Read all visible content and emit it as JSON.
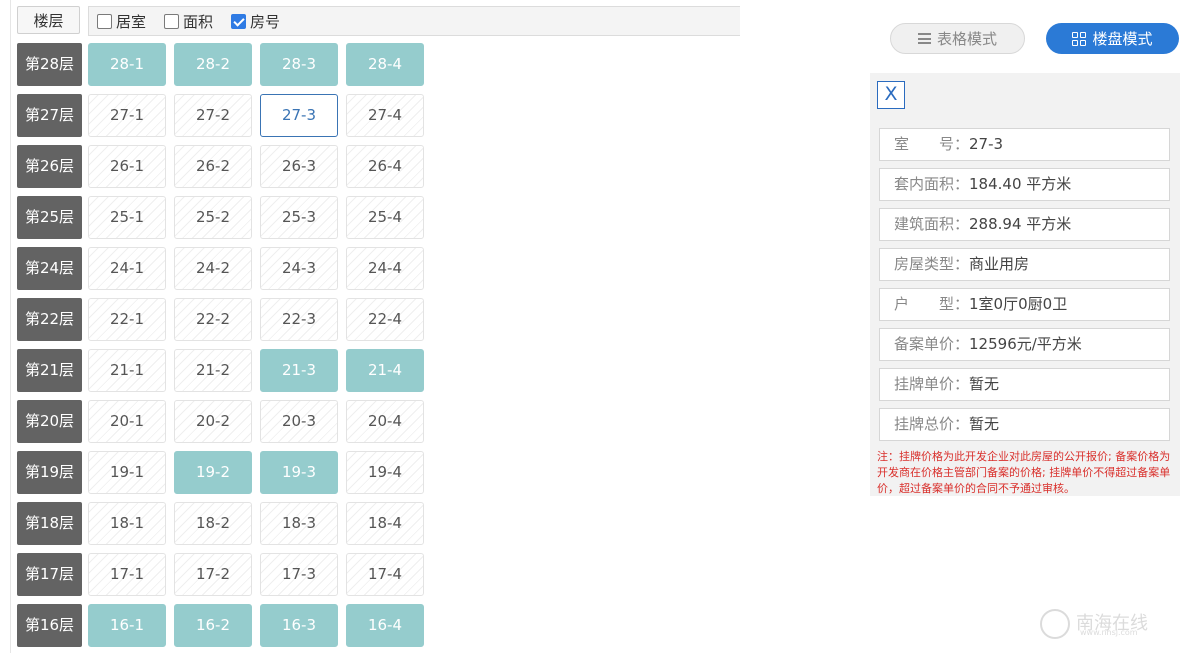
{
  "toolbar": {
    "floor_header": "楼层",
    "options": [
      {
        "label": "居室",
        "checked": false
      },
      {
        "label": "面积",
        "checked": false
      },
      {
        "label": "房号",
        "checked": true
      }
    ]
  },
  "floors": [
    {
      "label": "第28层",
      "units": [
        {
          "name": "28-1",
          "status": "sold"
        },
        {
          "name": "28-2",
          "status": "sold"
        },
        {
          "name": "28-3",
          "status": "sold"
        },
        {
          "name": "28-4",
          "status": "sold"
        }
      ]
    },
    {
      "label": "第27层",
      "units": [
        {
          "name": "27-1",
          "status": "available"
        },
        {
          "name": "27-2",
          "status": "available"
        },
        {
          "name": "27-3",
          "status": "selected"
        },
        {
          "name": "27-4",
          "status": "available"
        }
      ]
    },
    {
      "label": "第26层",
      "units": [
        {
          "name": "26-1",
          "status": "available"
        },
        {
          "name": "26-2",
          "status": "available"
        },
        {
          "name": "26-3",
          "status": "available"
        },
        {
          "name": "26-4",
          "status": "available"
        }
      ]
    },
    {
      "label": "第25层",
      "units": [
        {
          "name": "25-1",
          "status": "available"
        },
        {
          "name": "25-2",
          "status": "available"
        },
        {
          "name": "25-3",
          "status": "available"
        },
        {
          "name": "25-4",
          "status": "available"
        }
      ]
    },
    {
      "label": "第24层",
      "units": [
        {
          "name": "24-1",
          "status": "available"
        },
        {
          "name": "24-2",
          "status": "available"
        },
        {
          "name": "24-3",
          "status": "available"
        },
        {
          "name": "24-4",
          "status": "available"
        }
      ]
    },
    {
      "label": "第22层",
      "units": [
        {
          "name": "22-1",
          "status": "available"
        },
        {
          "name": "22-2",
          "status": "available"
        },
        {
          "name": "22-3",
          "status": "available"
        },
        {
          "name": "22-4",
          "status": "available"
        }
      ]
    },
    {
      "label": "第21层",
      "units": [
        {
          "name": "21-1",
          "status": "available"
        },
        {
          "name": "21-2",
          "status": "available"
        },
        {
          "name": "21-3",
          "status": "sold"
        },
        {
          "name": "21-4",
          "status": "sold"
        }
      ]
    },
    {
      "label": "第20层",
      "units": [
        {
          "name": "20-1",
          "status": "available"
        },
        {
          "name": "20-2",
          "status": "available"
        },
        {
          "name": "20-3",
          "status": "available"
        },
        {
          "name": "20-4",
          "status": "available"
        }
      ]
    },
    {
      "label": "第19层",
      "units": [
        {
          "name": "19-1",
          "status": "available"
        },
        {
          "name": "19-2",
          "status": "sold"
        },
        {
          "name": "19-3",
          "status": "sold"
        },
        {
          "name": "19-4",
          "status": "available"
        }
      ]
    },
    {
      "label": "第18层",
      "units": [
        {
          "name": "18-1",
          "status": "available"
        },
        {
          "name": "18-2",
          "status": "available"
        },
        {
          "name": "18-3",
          "status": "available"
        },
        {
          "name": "18-4",
          "status": "available"
        }
      ]
    },
    {
      "label": "第17层",
      "units": [
        {
          "name": "17-1",
          "status": "available"
        },
        {
          "name": "17-2",
          "status": "available"
        },
        {
          "name": "17-3",
          "status": "available"
        },
        {
          "name": "17-4",
          "status": "available"
        }
      ]
    },
    {
      "label": "第16层",
      "units": [
        {
          "name": "16-1",
          "status": "sold"
        },
        {
          "name": "16-2",
          "status": "sold"
        },
        {
          "name": "16-3",
          "status": "sold"
        },
        {
          "name": "16-4",
          "status": "sold"
        }
      ]
    }
  ],
  "view_modes": {
    "table": "表格模式",
    "building": "楼盘模式"
  },
  "detail": {
    "close": "X",
    "rows": [
      {
        "label": "室　　号：",
        "value": "27-3"
      },
      {
        "label": "套内面积：",
        "value": "184.40 平方米"
      },
      {
        "label": "建筑面积：",
        "value": "288.94 平方米"
      },
      {
        "label": "房屋类型：",
        "value": "商业用房"
      },
      {
        "label": "户　　型：",
        "value": "1室0厅0厨0卫"
      },
      {
        "label": "备案单价：",
        "value": "12596元/平方米"
      },
      {
        "label": "挂牌单价：",
        "value": "暂无"
      },
      {
        "label": "挂牌总价：",
        "value": "暂无"
      }
    ],
    "note": "注：挂牌价格为此开发企业对此房屋的公开报价; 备案价格为开发商在价格主管部门备案的价格; 挂牌单价不得超过备案单价，超过备案单价的合同不予通过审核。"
  },
  "watermark": {
    "text": "南海在线",
    "url": "www.nhsj.com"
  },
  "colors": {
    "sold": "#95cccd",
    "selected_border": "#3a74b4",
    "floor_label_bg": "#636363",
    "building_btn": "#2b7ad6",
    "note_text": "#d9302c"
  }
}
